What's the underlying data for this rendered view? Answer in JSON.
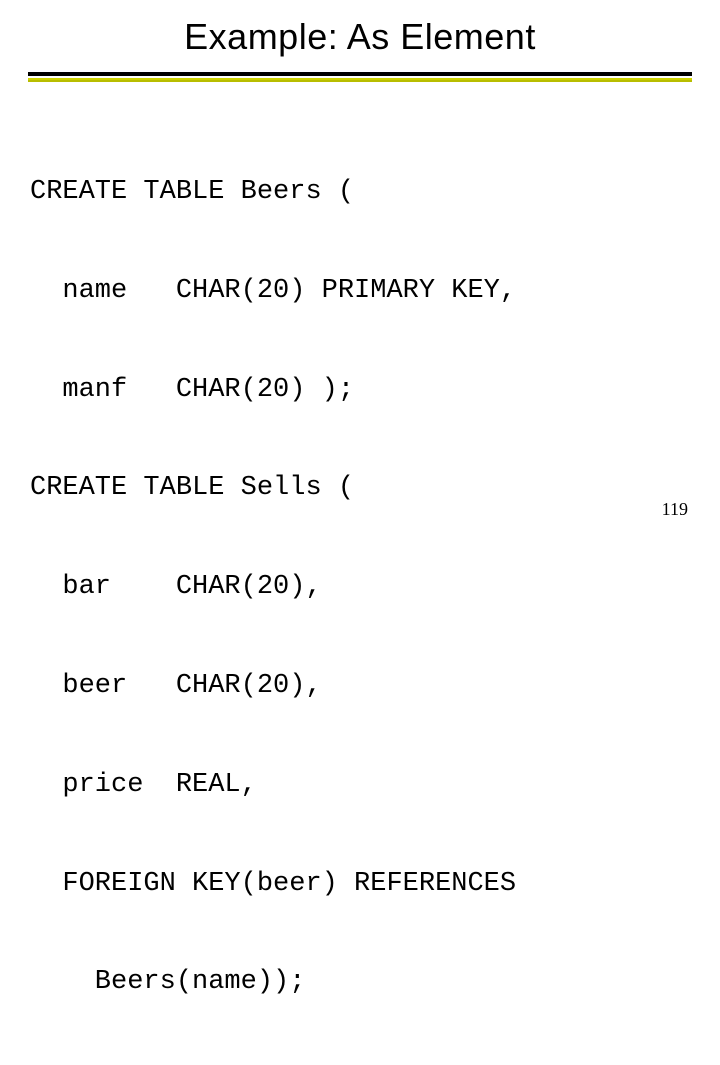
{
  "title": "Example: As Element",
  "code_lines": [
    "CREATE TABLE Beers (",
    "  name   CHAR(20) PRIMARY KEY,",
    "  manf   CHAR(20) );",
    "CREATE TABLE Sells (",
    "  bar    CHAR(20),",
    "  beer   CHAR(20),",
    "  price  REAL,",
    "  FOREIGN KEY(beer) REFERENCES ",
    "    Beers(name));"
  ],
  "page_number": "119",
  "accent_color": "#cfd400"
}
